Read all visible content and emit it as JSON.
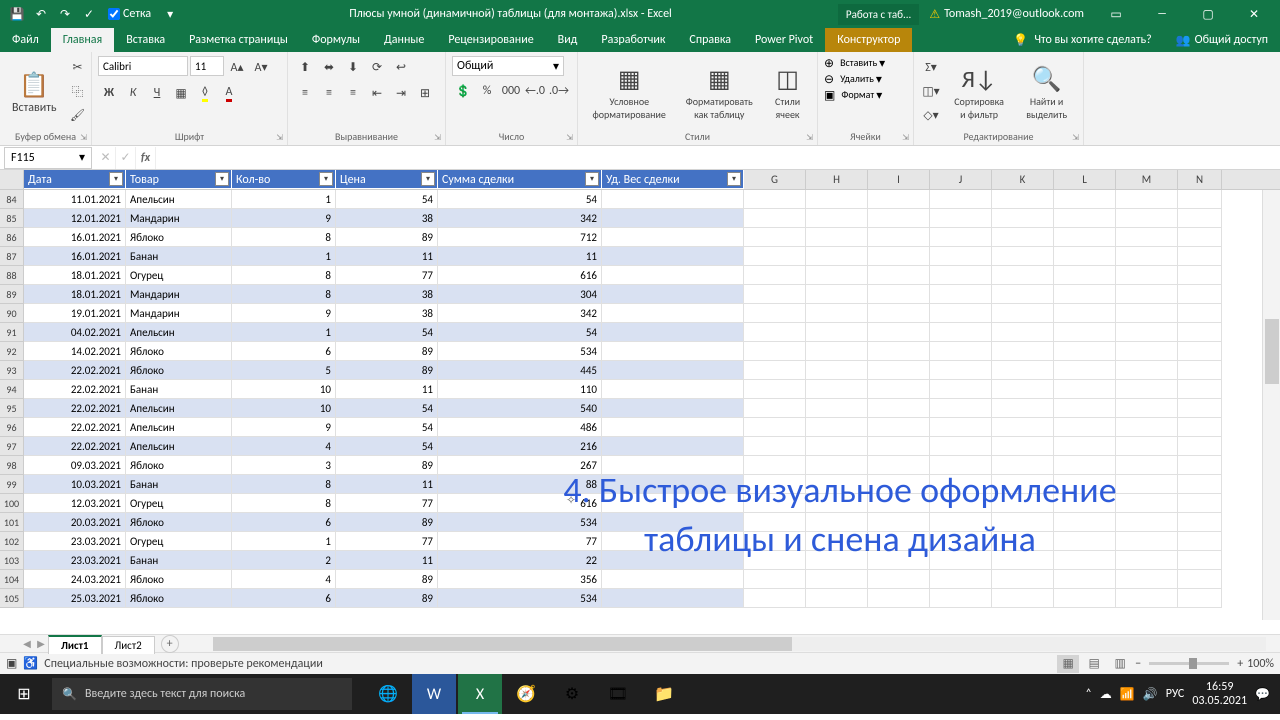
{
  "title_bar": {
    "save_icon": "save",
    "undo_icon": "undo",
    "redo_icon": "redo",
    "grid_checkbox_label": "Сетка",
    "grid_checked": true,
    "document_title": "Плюсы умной (динамичной) таблицы (для монтажа).xlsx - Excel",
    "context_chip": "Работа с таб...",
    "user_email": "Tomash_2019@outlook.com"
  },
  "ribbon_tabs": {
    "file": "Файл",
    "home": "Главная",
    "insert": "Вставка",
    "layout": "Разметка страницы",
    "formulas": "Формулы",
    "data": "Данные",
    "review": "Рецензирование",
    "view": "Вид",
    "developer": "Разработчик",
    "help": "Справка",
    "powerpivot": "Power Pivot",
    "design": "Конструктор",
    "tell_me": "Что вы хотите сделать?",
    "share": "Общий доступ"
  },
  "ribbon": {
    "clipboard": {
      "paste": "Вставить",
      "label": "Буфер обмена"
    },
    "font": {
      "name": "Calibri",
      "size": "11",
      "label": "Шрифт"
    },
    "alignment": {
      "label": "Выравнивание"
    },
    "number": {
      "format": "Общий",
      "label": "Число"
    },
    "styles": {
      "conditional": "Условное форматирование",
      "as_table": "Форматировать как таблицу",
      "cell_styles": "Стили ячеек",
      "label": "Стили"
    },
    "cells": {
      "insert": "Вставить",
      "delete": "Удалить",
      "format": "Формат",
      "label": "Ячейки"
    },
    "editing": {
      "sort": "Сортировка и фильтр",
      "find": "Найти и выделить",
      "label": "Редактирование"
    }
  },
  "name_box": "F115",
  "table": {
    "headers": [
      "Дата",
      "Товар",
      "Кол-во",
      "Цена",
      "Сумма сделки",
      "Уд. Вес сделки"
    ],
    "extra_cols": [
      "G",
      "H",
      "I",
      "J",
      "K",
      "L",
      "M",
      "N"
    ],
    "rows": [
      {
        "n": 84,
        "d": "11.01.2021",
        "t": "Апельсин",
        "q": 1,
        "p": 54,
        "s": 54
      },
      {
        "n": 85,
        "d": "12.01.2021",
        "t": "Мандарин",
        "q": 9,
        "p": 38,
        "s": 342
      },
      {
        "n": 86,
        "d": "16.01.2021",
        "t": "Яблоко",
        "q": 8,
        "p": 89,
        "s": 712
      },
      {
        "n": 87,
        "d": "16.01.2021",
        "t": "Банан",
        "q": 1,
        "p": 11,
        "s": 11
      },
      {
        "n": 88,
        "d": "18.01.2021",
        "t": "Огурец",
        "q": 8,
        "p": 77,
        "s": 616
      },
      {
        "n": 89,
        "d": "18.01.2021",
        "t": "Мандарин",
        "q": 8,
        "p": 38,
        "s": 304
      },
      {
        "n": 90,
        "d": "19.01.2021",
        "t": "Мандарин",
        "q": 9,
        "p": 38,
        "s": 342
      },
      {
        "n": 91,
        "d": "04.02.2021",
        "t": "Апельсин",
        "q": 1,
        "p": 54,
        "s": 54
      },
      {
        "n": 92,
        "d": "14.02.2021",
        "t": "Яблоко",
        "q": 6,
        "p": 89,
        "s": 534
      },
      {
        "n": 93,
        "d": "22.02.2021",
        "t": "Яблоко",
        "q": 5,
        "p": 89,
        "s": 445
      },
      {
        "n": 94,
        "d": "22.02.2021",
        "t": "Банан",
        "q": 10,
        "p": 11,
        "s": 110
      },
      {
        "n": 95,
        "d": "22.02.2021",
        "t": "Апельсин",
        "q": 10,
        "p": 54,
        "s": 540
      },
      {
        "n": 96,
        "d": "22.02.2021",
        "t": "Апельсин",
        "q": 9,
        "p": 54,
        "s": 486
      },
      {
        "n": 97,
        "d": "22.02.2021",
        "t": "Апельсин",
        "q": 4,
        "p": 54,
        "s": 216
      },
      {
        "n": 98,
        "d": "09.03.2021",
        "t": "Яблоко",
        "q": 3,
        "p": 89,
        "s": 267
      },
      {
        "n": 99,
        "d": "10.03.2021",
        "t": "Банан",
        "q": 8,
        "p": 11,
        "s": 88
      },
      {
        "n": 100,
        "d": "12.03.2021",
        "t": "Огурец",
        "q": 8,
        "p": 77,
        "s": 616
      },
      {
        "n": 101,
        "d": "20.03.2021",
        "t": "Яблоко",
        "q": 6,
        "p": 89,
        "s": 534
      },
      {
        "n": 102,
        "d": "23.03.2021",
        "t": "Огурец",
        "q": 1,
        "p": 77,
        "s": 77
      },
      {
        "n": 103,
        "d": "23.03.2021",
        "t": "Банан",
        "q": 2,
        "p": 11,
        "s": 22
      },
      {
        "n": 104,
        "d": "24.03.2021",
        "t": "Яблоко",
        "q": 4,
        "p": 89,
        "s": 356
      },
      {
        "n": 105,
        "d": "25.03.2021",
        "t": "Яблоко",
        "q": 6,
        "p": 89,
        "s": 534
      }
    ]
  },
  "overlay_text": "4. Быстрое визуальное оформление таблицы и снена дизайна",
  "sheet_tabs": {
    "s1": "Лист1",
    "s2": "Лист2"
  },
  "status": {
    "accessibility": "Специальные возможности: проверьте рекомендации",
    "zoom": "100%"
  },
  "taskbar": {
    "search_placeholder": "Введите здесь текст для поиска",
    "lang": "РУС",
    "time": "16:59",
    "date": "03.05.2021"
  }
}
